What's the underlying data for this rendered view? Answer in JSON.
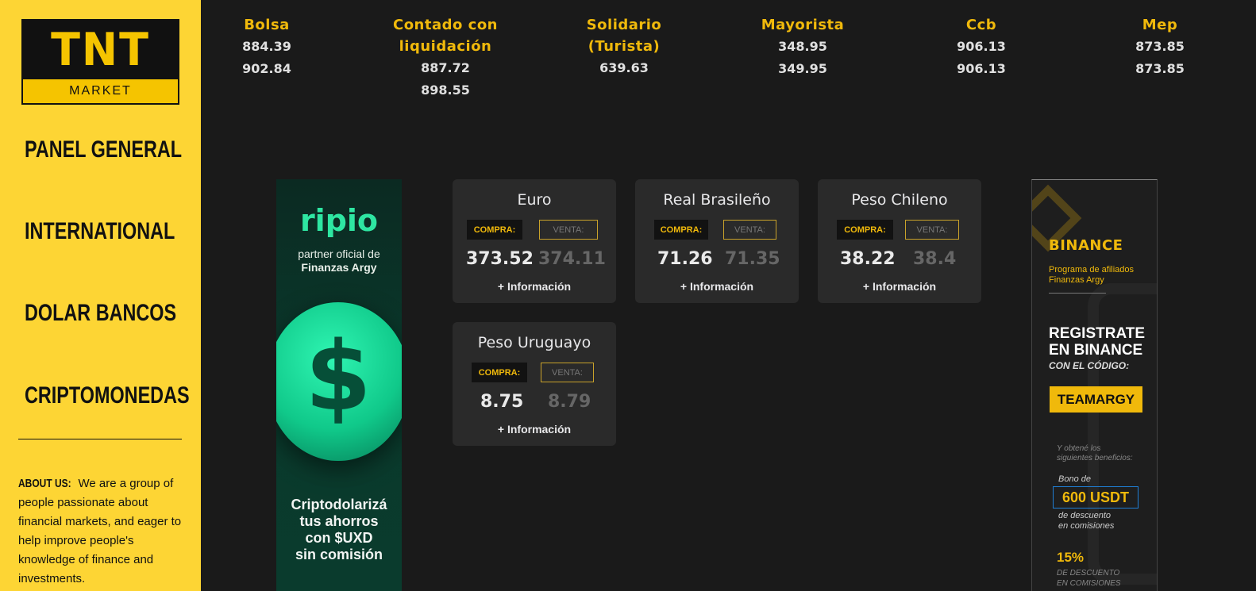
{
  "sidebar": {
    "logo_top": "TNT",
    "logo_bottom": "MARKET",
    "nav": [
      "PANEL GENERAL",
      "INTERNATIONAL",
      "DOLAR BANCOS",
      "CRIPTOMONEDAS"
    ],
    "about_label": "ABOUT US:",
    "about_text": "We are a group of people passionate about financial markets, and eager to help improve people's knowledge of finance and investments."
  },
  "ticker": [
    {
      "name_1": "Bolsa",
      "name_2": "",
      "v1": "884.39",
      "v2": "902.84"
    },
    {
      "name_1": "Contado con",
      "name_2": "liquidación",
      "v1": "887.72",
      "v2": "898.55"
    },
    {
      "name_1": "Solidario",
      "name_2": "(Turista)",
      "v1": "639.63",
      "v2": ""
    },
    {
      "name_1": "Mayorista",
      "name_2": "",
      "v1": "348.95",
      "v2": "349.95"
    },
    {
      "name_1": "Ccb",
      "name_2": "",
      "v1": "906.13",
      "v2": "906.13"
    },
    {
      "name_1": "Mep",
      "name_2": "",
      "v1": "873.85",
      "v2": "873.85"
    }
  ],
  "ripio": {
    "logo": "ripio",
    "sub_1": "partner oficial de",
    "sub_2": "Finanzas Argy",
    "coin": "$",
    "bottom_1": "Criptodolarizá",
    "bottom_2": "tus ahorros",
    "bottom_3": "con $UXD",
    "bottom_4": "sin comisión"
  },
  "binance": {
    "title": "BINANCE",
    "prog_1": "Programa de afiliados",
    "prog_2": "Finanzas Argy",
    "reg_1": "REGISTRATE",
    "reg_2": "EN BINANCE",
    "code_label": "CON EL CÓDIGO:",
    "code": "TEAMARGY",
    "obt_1": "Y obtené los",
    "obt_2": "siguientes beneficios:",
    "bono": "Bono de",
    "usdt": "600 USDT",
    "desc_1": "de descuento",
    "desc_2": "en comisiones",
    "pct": "15%",
    "pct_1": "DE DESCUENTO",
    "pct_2": "EN COMISIONES"
  },
  "labels": {
    "buy": "COMPRA:",
    "sell": "VENTA:",
    "more": "+ Información"
  },
  "cards": [
    {
      "title": "Euro",
      "buy": "373.52",
      "sell": "374.11"
    },
    {
      "title": "Real Brasileño",
      "buy": "71.26",
      "sell": "71.35"
    },
    {
      "title": "Peso Chileno",
      "buy": "38.22",
      "sell": "38.4"
    },
    {
      "title": "Peso Uruguayo",
      "buy": "8.75",
      "sell": "8.79"
    }
  ]
}
